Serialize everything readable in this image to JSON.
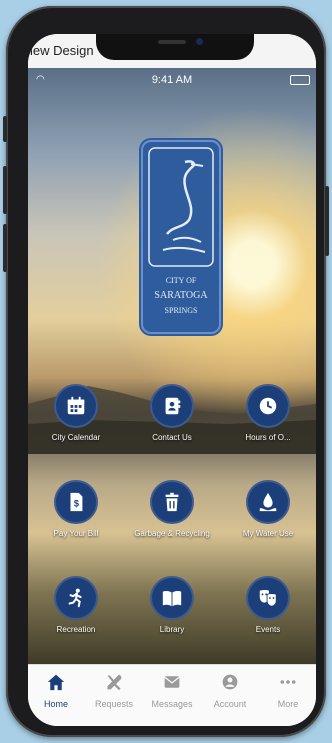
{
  "app": {
    "top_title": "iew Design",
    "status_time": "9:41 AM",
    "logo": {
      "line1": "CITY OF",
      "line2": "SARATOGA",
      "line3": "SPRINGS"
    }
  },
  "tiles": [
    {
      "label": "City Calendar",
      "icon": "calendar-icon"
    },
    {
      "label": "Contact Us",
      "icon": "contact-book-icon"
    },
    {
      "label": "Hours of O...",
      "icon": "clock-icon"
    },
    {
      "label": "Pay Your Bill",
      "icon": "bill-icon"
    },
    {
      "label": "Garbage & Recycling",
      "icon": "trash-icon"
    },
    {
      "label": "My Water Use",
      "icon": "water-drop-icon"
    },
    {
      "label": "Recreation",
      "icon": "running-person-icon"
    },
    {
      "label": "Library",
      "icon": "book-icon"
    },
    {
      "label": "Events",
      "icon": "theater-masks-icon"
    }
  ],
  "tabbar": [
    {
      "label": "Home",
      "icon": "home-icon",
      "active": true
    },
    {
      "label": "Requests",
      "icon": "tools-icon",
      "active": false
    },
    {
      "label": "Messages",
      "icon": "envelope-icon",
      "active": false
    },
    {
      "label": "Account",
      "icon": "user-icon",
      "active": false
    },
    {
      "label": "More",
      "icon": "more-dots-icon",
      "active": false
    }
  ],
  "colors": {
    "brand": "#1c3f7a",
    "logo_fill": "#2f5c9d",
    "page_bg": "#a9cfe6"
  }
}
